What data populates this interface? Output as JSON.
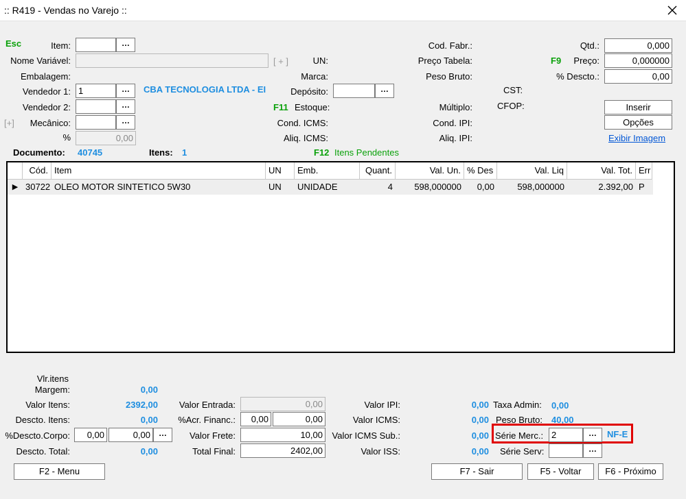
{
  "window": {
    "title": ":: R419 - Vendas no Varejo ::"
  },
  "form": {
    "esc": "Esc",
    "item_label": "Item:",
    "item_value": "",
    "nome_variavel_label": "Nome Variável:",
    "nome_variavel_value": "",
    "plus_bracket": "[ + ]",
    "un_label": "UN:",
    "embalagem_label": "Embalagem:",
    "marca_label": "Marca:",
    "vendedor1_label": "Vendedor 1:",
    "vendedor1_value": "1",
    "vendedor1_name": "CBA TECNOLOGIA LTDA - EI",
    "deposito_label": "Depósito:",
    "deposito_value": "",
    "vendedor2_label": "Vendedor 2:",
    "vendedor2_value": "",
    "f11": "F11",
    "estoque_label": "Estoque:",
    "mecanico_bracket": "[+]",
    "mecanico_label": "Mecânico:",
    "mecanico_value": "",
    "cond_icms_label": "Cond. ICMS:",
    "pct_label": "%",
    "pct_value": "0,00",
    "aliq_icms_label": "Aliq. ICMS:",
    "cod_fabr_label": "Cod. Fabr.:",
    "preco_tabela_label": "Preço Tabela:",
    "peso_bruto_label": "Peso Bruto:",
    "cst_label": "CST:",
    "multiplo_label": "Múltiplo:",
    "cfop_label": "CFOP:",
    "cond_ipi_label": "Cond. IPI:",
    "aliq_ipi_label": "Aliq. IPI:",
    "qtd_label": "Qtd.:",
    "qtd_value": "0,000",
    "f9": "F9",
    "preco_label": "Preço:",
    "preco_value": "0,000000",
    "pct_descto_label": "% Descto.:",
    "pct_descto_value": "0,00",
    "inserir_button": "Inserir",
    "opcoes_button": "Opções",
    "exibir_imagem_link": "Exibir Imagem",
    "documento_label": "Documento:",
    "documento_value": "40745",
    "itens_label": "Itens:",
    "itens_value": "1",
    "f12": "F12",
    "itens_pendentes": "Itens Pendentes"
  },
  "grid": {
    "columns": [
      "Cód.",
      "Item",
      "UN",
      "Emb.",
      "Quant.",
      "Val. Un.",
      "% Des",
      "Val. Liq",
      "Val. Tot.",
      "Err"
    ],
    "rows": [
      {
        "indicator": "▶",
        "cod": "30722",
        "item": "OLEO MOTOR SINTETICO 5W30",
        "un": "UN",
        "emb": "UNIDADE",
        "quant": "4",
        "val_un": "598,000000",
        "pct_des": "0,00",
        "val_liq": "598,000000",
        "val_tot": "2.392,00",
        "err": "P"
      }
    ]
  },
  "totals": {
    "vlr_itens_margem_label_1": "Vlr.itens",
    "vlr_itens_margem_label_2": "Margem:",
    "vlr_itens_margem_value": "0,00",
    "valor_itens_label": "Valor Itens:",
    "valor_itens_value": "2392,00",
    "descto_itens_label": "Descto. Itens:",
    "descto_itens_value": "0,00",
    "descto_corpo_label": "%Descto.Corpo:",
    "descto_corpo_pct": "0,00",
    "descto_corpo_value": "0,00",
    "descto_total_label": "Descto. Total:",
    "descto_total_value": "0,00",
    "valor_entrada_label": "Valor Entrada:",
    "valor_entrada_value": "0,00",
    "acr_financ_label": "%Acr. Financ.:",
    "acr_financ_pct": "0,00",
    "acr_financ_value": "0,00",
    "valor_frete_label": "Valor Frete:",
    "valor_frete_value": "10,00",
    "total_final_label": "Total Final:",
    "total_final_value": "2402,00",
    "valor_ipi_label": "Valor IPI:",
    "valor_ipi_value": "0,00",
    "valor_icms_label": "Valor ICMS:",
    "valor_icms_value": "0,00",
    "valor_icms_sub_label": "Valor ICMS Sub.:",
    "valor_icms_sub_value": "0,00",
    "valor_iss_label": "Valor ISS:",
    "valor_iss_value": "0,00",
    "taxa_admin_label": "Taxa Admin:",
    "taxa_admin_value": "0,00",
    "peso_bruto_label": "Peso Bruto:",
    "peso_bruto_value": "40,00",
    "serie_merc_label": "Série Merc.:",
    "serie_merc_value": "2",
    "nfe_label": "NF-E",
    "serie_serv_label": "Série Serv:",
    "serie_serv_value": ""
  },
  "footer": {
    "f2_menu": "F2 - Menu",
    "f7_sair": "F7 - Sair",
    "f5_voltar": "F5 - Voltar",
    "f6_proximo": "F6 - Próximo"
  },
  "icons": {
    "close": "close-icon",
    "row_pointer": "row-pointer-icon"
  },
  "colors": {
    "accent_green": "#0aa10a",
    "accent_blue": "#1e8ee0",
    "highlight_red": "#e00000"
  }
}
